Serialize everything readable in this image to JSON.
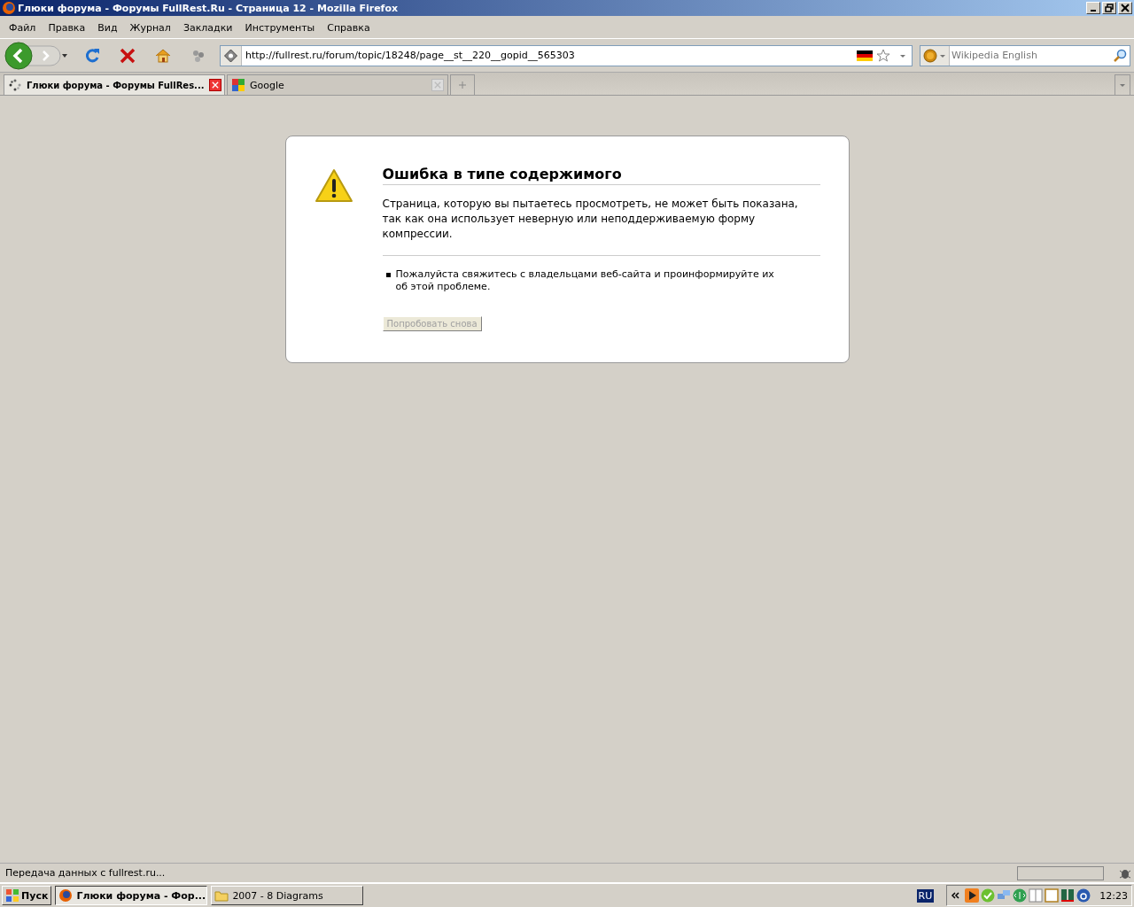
{
  "window": {
    "title": "Глюки форума - Форумы FullRest.Ru - Страница 12 - Mozilla Firefox"
  },
  "menu": [
    "Файл",
    "Правка",
    "Вид",
    "Журнал",
    "Закладки",
    "Инструменты",
    "Справка"
  ],
  "navigation": {
    "url": "http://fullrest.ru/forum/topic/18248/page__st__220__gopid__565303",
    "search": {
      "placeholder": "Wikipedia English"
    }
  },
  "tabs": [
    {
      "label": "Глюки форума - Форумы FullRes...",
      "selected": true
    },
    {
      "label": "Google",
      "selected": false
    }
  ],
  "error": {
    "title": "Ошибка в типе содержимого",
    "text": "Страница, которую вы пытаетесь просмотреть, не может быть показана, так как она использует неверную или неподдерживаемую форму компрессии.",
    "bullets": [
      "Пожалуйста свяжитесь с владельцами веб-сайта и проинформируйте их об этой проблеме."
    ],
    "button": {
      "label": "Попробовать снова",
      "disabled": true
    }
  },
  "status_bar": {
    "text": "Передача данных с fullrest.ru..."
  },
  "taskbar": {
    "start": "Пуск",
    "tasks": [
      {
        "label": "Глюки форума - Фор...",
        "selected": true,
        "kind": "browser"
      },
      {
        "label": "2007 - 8 Diagrams",
        "selected": false,
        "kind": "folder"
      }
    ],
    "language": "RU",
    "clock": "12:23"
  }
}
